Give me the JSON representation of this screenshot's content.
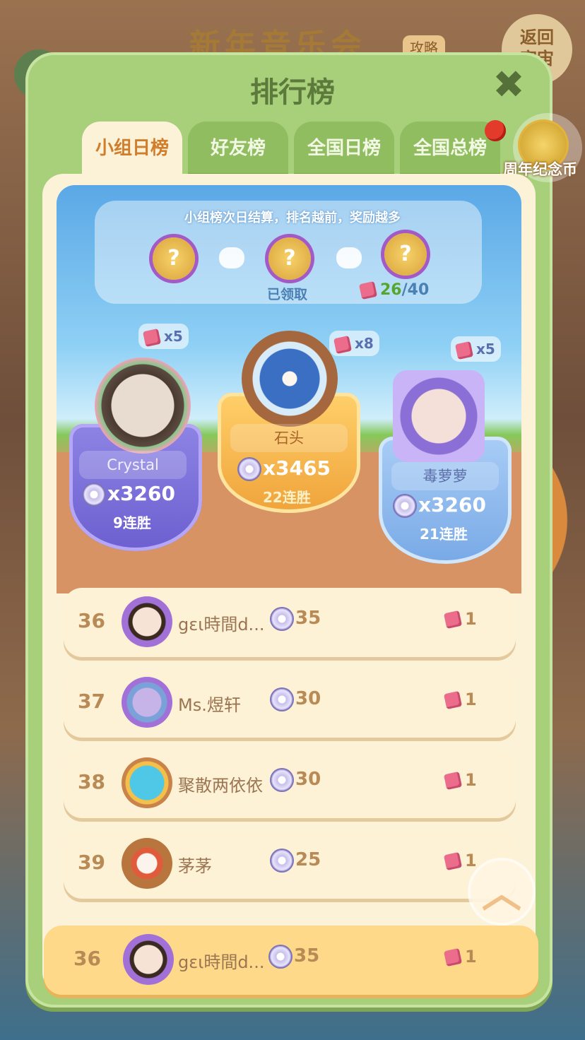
{
  "background": {
    "event_title": "新年音乐会",
    "guide_tag": "攻略",
    "back_button": "返回\n宇宙"
  },
  "panel": {
    "title": "排行榜",
    "close_icon": "close-icon"
  },
  "tabs": [
    {
      "label": "小组日榜",
      "active": true
    },
    {
      "label": "好友榜",
      "active": false
    },
    {
      "label": "全国日榜",
      "active": false
    },
    {
      "label": "全国总榜",
      "active": false
    }
  ],
  "anniversary_coin": {
    "label": "周年纪念币"
  },
  "rewards": {
    "hint": "小组榜次日结算，排名越前，奖励越多",
    "claimed_label": "已领取",
    "progress_current": "26",
    "progress_total": "/40"
  },
  "podium": [
    {
      "place": 2,
      "name": "Crystal",
      "score": "x3260",
      "streak": "9连胜",
      "pieces": "x5"
    },
    {
      "place": 1,
      "name": "石头",
      "score": "x3465",
      "streak": "22连胜",
      "pieces": "x8"
    },
    {
      "place": 3,
      "name": "毒萝萝",
      "score": "x3260",
      "streak": "21连胜",
      "pieces": "x5"
    }
  ],
  "rows": [
    {
      "rank": "36",
      "name": "gɛι時間d...",
      "score": "35",
      "pieces": "1"
    },
    {
      "rank": "37",
      "name": "Ms.煜轩",
      "score": "30",
      "pieces": "1"
    },
    {
      "rank": "38",
      "name": "聚散两依依",
      "score": "30",
      "pieces": "1"
    },
    {
      "rank": "39",
      "name": "茅茅",
      "score": "25",
      "pieces": "1"
    }
  ],
  "my_row": {
    "rank": "36",
    "name": "gɛι時間d...",
    "score": "35",
    "pieces": "1"
  },
  "colors": {
    "panel": "#a8cf7a",
    "tab_active_text": "#d07d2c",
    "row_bg": "#fdf1d6",
    "my_row_bg": "#ffd98a"
  }
}
